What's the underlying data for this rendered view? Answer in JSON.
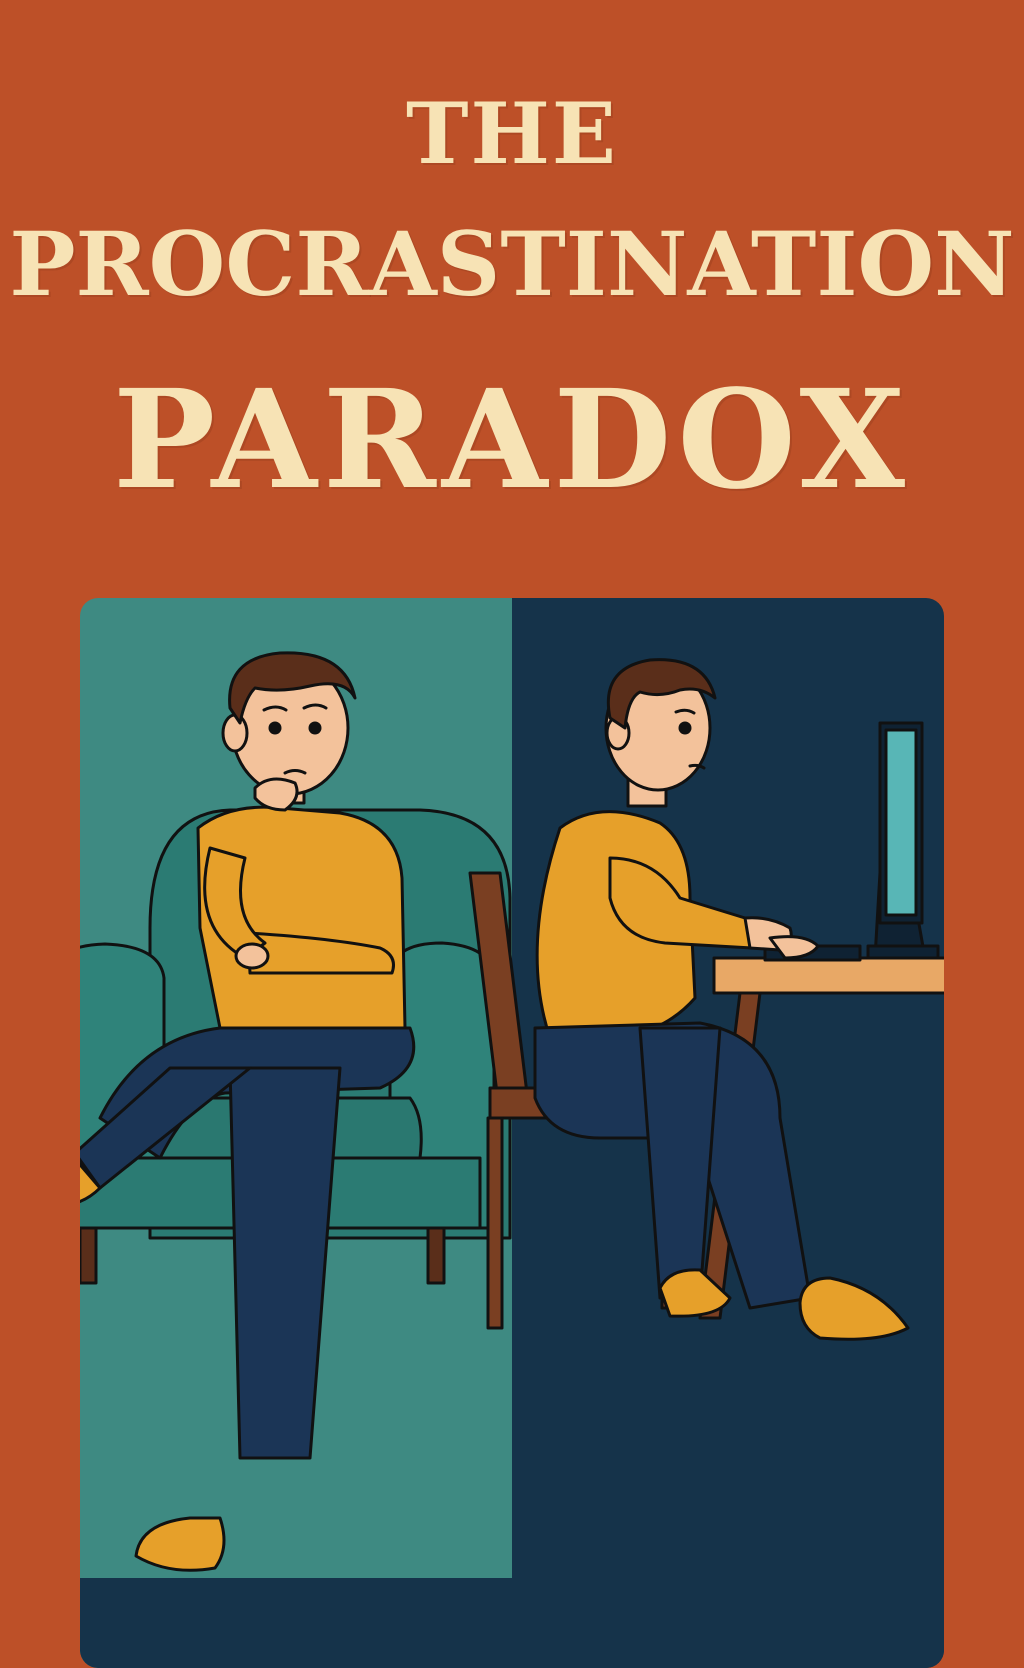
{
  "cover": {
    "title_lines": [
      "THE",
      "PROCRASTINATION",
      "PARADOX"
    ],
    "colors": {
      "background": "#bd5028",
      "title": "#f7e3b5",
      "left_panel": "#3e8a82",
      "right_panel": "#15334a",
      "sweater": "#e6a02a",
      "pants": "#1b3556",
      "armchair": "#2b7b73",
      "skin": "#f3c29b",
      "hair": "#5a2e1a",
      "desk": "#e8a866",
      "chair": "#7a3f22"
    },
    "illustration": {
      "left_scene": "person-thinking-in-armchair",
      "right_scene": "person-working-at-computer"
    }
  }
}
